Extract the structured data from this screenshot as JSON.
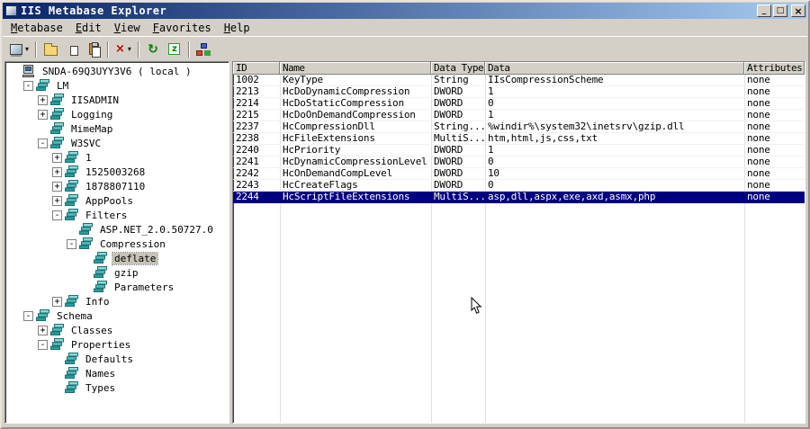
{
  "window": {
    "title": "IIS Metabase Explorer",
    "controls": {
      "minimize": "_",
      "maximize": "□",
      "close": "×"
    }
  },
  "menu": {
    "items": [
      {
        "label": "Metabase"
      },
      {
        "label": "Edit"
      },
      {
        "label": "View"
      },
      {
        "label": "Favorites"
      },
      {
        "label": "Help"
      }
    ]
  },
  "toolbar": {
    "buttons": [
      {
        "name": "connect-server-button",
        "icon": "computer-icon",
        "dropdown": true
      },
      {
        "separator": true
      },
      {
        "name": "open-key-button",
        "icon": "folder-icon"
      },
      {
        "name": "copy-button",
        "icon": "copy-icon"
      },
      {
        "name": "paste-button",
        "icon": "paste-icon"
      },
      {
        "separator": true
      },
      {
        "name": "delete-button",
        "icon": "delete-icon",
        "glyph": "×",
        "glyph_color": "#c00000",
        "dropdown": true
      },
      {
        "separator": true
      },
      {
        "name": "refresh-button",
        "icon": "refresh-icon",
        "glyph": "↻",
        "glyph_color": "#008000"
      },
      {
        "name": "sort-button",
        "icon": "sort-icon",
        "glyph": "z",
        "glyph_color": "#008000"
      },
      {
        "separator": true
      },
      {
        "name": "network-button",
        "icon": "network-icon"
      }
    ]
  },
  "tree": {
    "items": [
      {
        "label": "SNDA-69Q3UYY3V6 ( local )",
        "level": 0,
        "expand": "none",
        "icon": "computer"
      },
      {
        "label": "LM",
        "level": 1,
        "expand": "minus",
        "icon": "key"
      },
      {
        "label": "IISADMIN",
        "level": 2,
        "expand": "plus",
        "icon": "key"
      },
      {
        "label": "Logging",
        "level": 2,
        "expand": "plus",
        "icon": "key"
      },
      {
        "label": "MimeMap",
        "level": 2,
        "expand": "none",
        "icon": "key"
      },
      {
        "label": "W3SVC",
        "level": 2,
        "expand": "minus",
        "icon": "key"
      },
      {
        "label": "1",
        "level": 3,
        "expand": "plus",
        "icon": "key"
      },
      {
        "label": "1525003268",
        "level": 3,
        "expand": "plus",
        "icon": "key"
      },
      {
        "label": "1878807110",
        "level": 3,
        "expand": "plus",
        "icon": "key"
      },
      {
        "label": "AppPools",
        "level": 3,
        "expand": "plus",
        "icon": "key"
      },
      {
        "label": "Filters",
        "level": 3,
        "expand": "minus",
        "icon": "key"
      },
      {
        "label": "ASP.NET_2.0.50727.0",
        "level": 4,
        "expand": "none",
        "icon": "key"
      },
      {
        "label": "Compression",
        "level": 4,
        "expand": "minus",
        "icon": "key"
      },
      {
        "label": "deflate",
        "level": 5,
        "expand": "none",
        "icon": "key",
        "selected": true
      },
      {
        "label": "gzip",
        "level": 5,
        "expand": "none",
        "icon": "key"
      },
      {
        "label": "Parameters",
        "level": 5,
        "expand": "none",
        "icon": "key"
      },
      {
        "label": "Info",
        "level": 3,
        "expand": "plus",
        "icon": "key"
      },
      {
        "label": "Schema",
        "level": 1,
        "expand": "minus",
        "icon": "key"
      },
      {
        "label": "Classes",
        "level": 2,
        "expand": "plus",
        "icon": "key"
      },
      {
        "label": "Properties",
        "level": 2,
        "expand": "minus",
        "icon": "key"
      },
      {
        "label": "Defaults",
        "level": 3,
        "expand": "none",
        "icon": "key"
      },
      {
        "label": "Names",
        "level": 3,
        "expand": "none",
        "icon": "key"
      },
      {
        "label": "Types",
        "level": 3,
        "expand": "none",
        "icon": "key"
      }
    ]
  },
  "table": {
    "columns": [
      "ID",
      "Name",
      "Data Type",
      "Data",
      "Attributes"
    ],
    "rows": [
      [
        "1002",
        "KeyType",
        "String",
        "IIsCompressionScheme",
        "none"
      ],
      [
        "2213",
        "HcDoDynamicCompression",
        "DWORD",
        "1",
        "none"
      ],
      [
        "2214",
        "HcDoStaticCompression",
        "DWORD",
        "0",
        "none"
      ],
      [
        "2215",
        "HcDoOnDemandCompression",
        "DWORD",
        "1",
        "none"
      ],
      [
        "2237",
        "HcCompressionDll",
        "String...",
        "%windir%\\system32\\inetsrv\\gzip.dll",
        "none"
      ],
      [
        "2238",
        "HcFileExtensions",
        "MultiS...",
        "htm,html,js,css,txt",
        "none"
      ],
      [
        "2240",
        "HcPriority",
        "DWORD",
        "1",
        "none"
      ],
      [
        "2241",
        "HcDynamicCompressionLevel",
        "DWORD",
        "0",
        "none"
      ],
      [
        "2242",
        "HcOnDemandCompLevel",
        "DWORD",
        "10",
        "none"
      ],
      [
        "2243",
        "HcCreateFlags",
        "DWORD",
        "0",
        "none"
      ],
      [
        "2244",
        "HcScriptFileExtensions",
        "MultiS...",
        "asp,dll,aspx,exe,axd,asmx,php",
        "none"
      ]
    ],
    "selected_row_id": "2244",
    "selected_index": 10
  },
  "colors": {
    "titlebar-start": "#0a246a",
    "titlebar-end": "#a6caf0",
    "chrome": "#d4d0c8",
    "selection": "#000080",
    "selection-text": "#ffffff",
    "inactive-selection": "#c6c3b6",
    "tree-icon-teal": "#2a9c9c"
  }
}
